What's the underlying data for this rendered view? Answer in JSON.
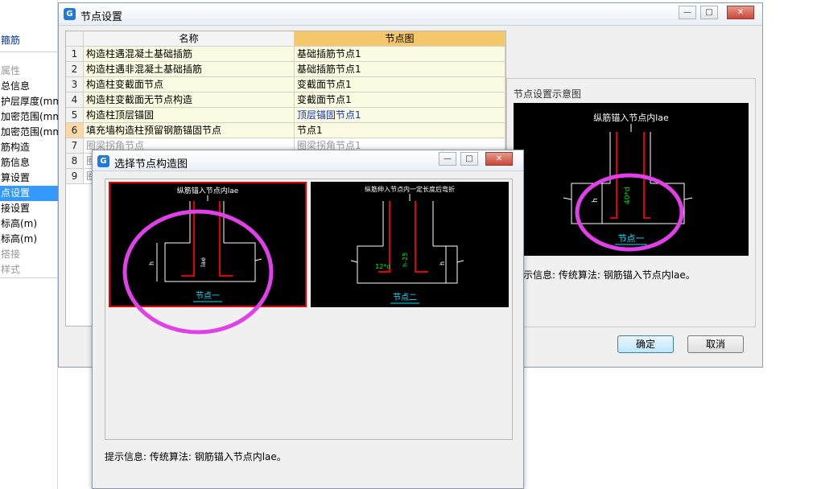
{
  "background_panel": {
    "items": [
      {
        "label": "箍筋",
        "style": "link"
      },
      {
        "label": "属性",
        "style": "gray"
      },
      {
        "label": "总信息",
        "style": ""
      },
      {
        "label": "护层厚度(mm)",
        "style": ""
      },
      {
        "label": "加密范围(mm)",
        "style": ""
      },
      {
        "label": "加密范围(mm)",
        "style": ""
      },
      {
        "label": "筋构造",
        "style": ""
      },
      {
        "label": "筋信息",
        "style": ""
      },
      {
        "label": "算设置",
        "style": ""
      },
      {
        "label": "点设置",
        "style": "sel"
      },
      {
        "label": "接设置",
        "style": ""
      },
      {
        "label": "标高(m)",
        "style": ""
      },
      {
        "label": "标高(m)",
        "style": ""
      },
      {
        "label": "搭接",
        "style": "gray"
      },
      {
        "label": "样式",
        "style": "gray"
      }
    ]
  },
  "main_dialog": {
    "title": "节点设置",
    "buttons": {
      "minimize": "—",
      "maximize": "□",
      "close": "✕"
    },
    "table": {
      "headers": {
        "name": "名称",
        "node": "节点图"
      },
      "rows": [
        {
          "idx": "1",
          "name": "构造柱遇混凝土基础插筋",
          "node": "基础插筋节点1",
          "node_blue": false,
          "gray": false
        },
        {
          "idx": "2",
          "name": "构造柱遇非混凝土基础插筋",
          "node": "基础插筋节点1",
          "node_blue": false,
          "gray": false
        },
        {
          "idx": "3",
          "name": "构造柱变截面节点",
          "node": "变截面节点1",
          "node_blue": false,
          "gray": false
        },
        {
          "idx": "4",
          "name": "构造柱变截面无节点构造",
          "node": "变截面节点1",
          "node_blue": false,
          "gray": false
        },
        {
          "idx": "5",
          "name": "构造柱顶层锚固",
          "node": "顶层锚固节点1",
          "node_blue": true,
          "gray": false
        },
        {
          "idx": "6",
          "name": "填充墙构造柱预留钢筋锚固节点",
          "node": "节点1",
          "node_blue": false,
          "gray": false
        },
        {
          "idx": "7",
          "name": "圈梁拐角节点",
          "node": "圈梁拐角节点1",
          "node_blue": false,
          "gray": true
        },
        {
          "idx": "8",
          "name": "圈",
          "node": "",
          "node_blue": false,
          "gray": true
        },
        {
          "idx": "9",
          "name": "圈",
          "node": "",
          "node_blue": false,
          "gray": true
        }
      ],
      "ellipsis": "···"
    },
    "preview": {
      "title": "节点设置示意图",
      "caption_top": "纵筋锚入节点内lae",
      "dim_h": "h",
      "dim_40d": "40*d",
      "node_label": "节点一",
      "hint": "示信息: 传统算法: 钢筋锚入节点内lae。"
    },
    "ok_label": "确定",
    "cancel_label": "取消"
  },
  "select_dialog": {
    "title": "选择节点构造图",
    "buttons": {
      "minimize": "—",
      "maximize": "□",
      "close": "✕"
    },
    "thumbs": [
      {
        "caption": "纵筋锚入节点内lae",
        "label": "节点一",
        "dim_h": "h",
        "dim_lae": "lae"
      },
      {
        "caption": "纵筋伸入节点内一定长度后弯折",
        "label": "节点二",
        "dim_12d": "12*d",
        "dim_lae": "h-25",
        "dim_h": "h"
      }
    ],
    "hint": "提示信息: 传统算法: 钢筋锚入节点内lae。"
  },
  "colors": {
    "highlight_ellipse": "#e040e8",
    "rebar": "#e00000",
    "node_label": "#00e5ff",
    "dim_text": "#00e000",
    "selection": "#3399ff",
    "header_node": "#f6c66a"
  }
}
